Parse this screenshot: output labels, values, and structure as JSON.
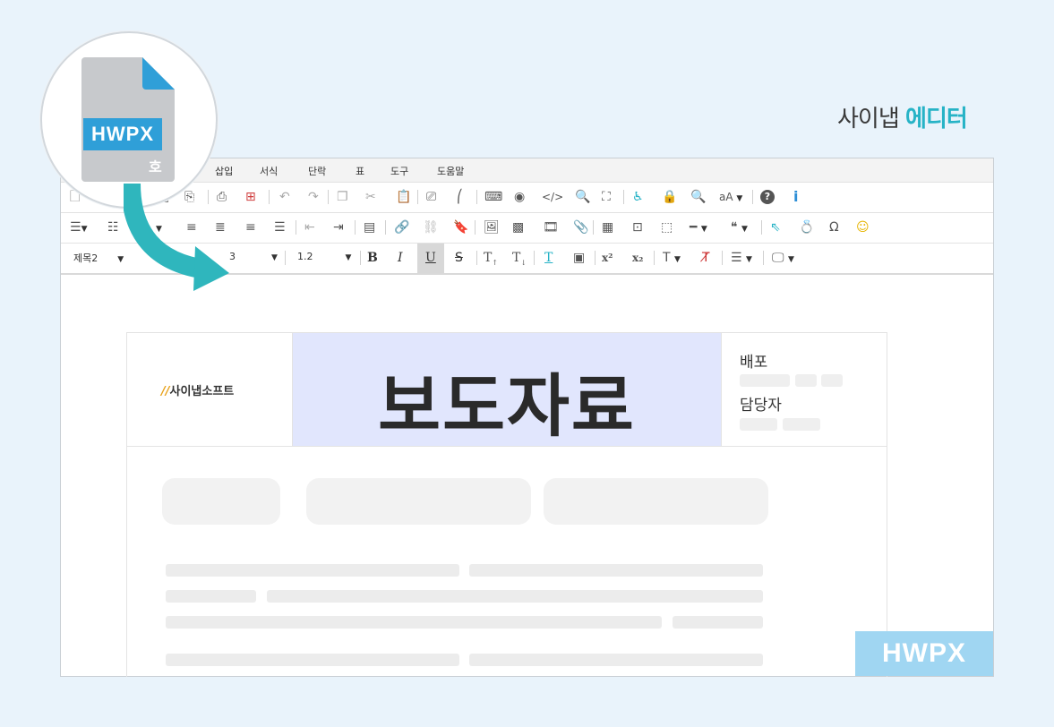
{
  "brand": {
    "name": "사이냅",
    "accent": "에디터"
  },
  "file_icon": {
    "label": "HWPX",
    "char": "호"
  },
  "menu": [
    "삽입",
    "서식",
    "단락",
    "표",
    "도구",
    "도움말"
  ],
  "toolbar": {
    "style_select": "제목2",
    "size_select": "3",
    "line_height_select": "1.2",
    "bold": "B",
    "italic": "I",
    "underline": "U",
    "strike": "S",
    "font_size_label": "aA",
    "help": "?",
    "info": "i",
    "omega": "Ω",
    "quote": "❝",
    "superscript": "x²",
    "subscript": "x₂"
  },
  "document": {
    "logo_text": "사이냅소프트",
    "title": "보도자료",
    "info_label_1": "배포",
    "info_label_2": "담당자"
  },
  "badge": "HWPX",
  "colors": {
    "accent": "#27b3c6",
    "badge": "#a0d6f2",
    "title_bg": "#e1e6fd",
    "file_blue": "#2f9fd8"
  }
}
